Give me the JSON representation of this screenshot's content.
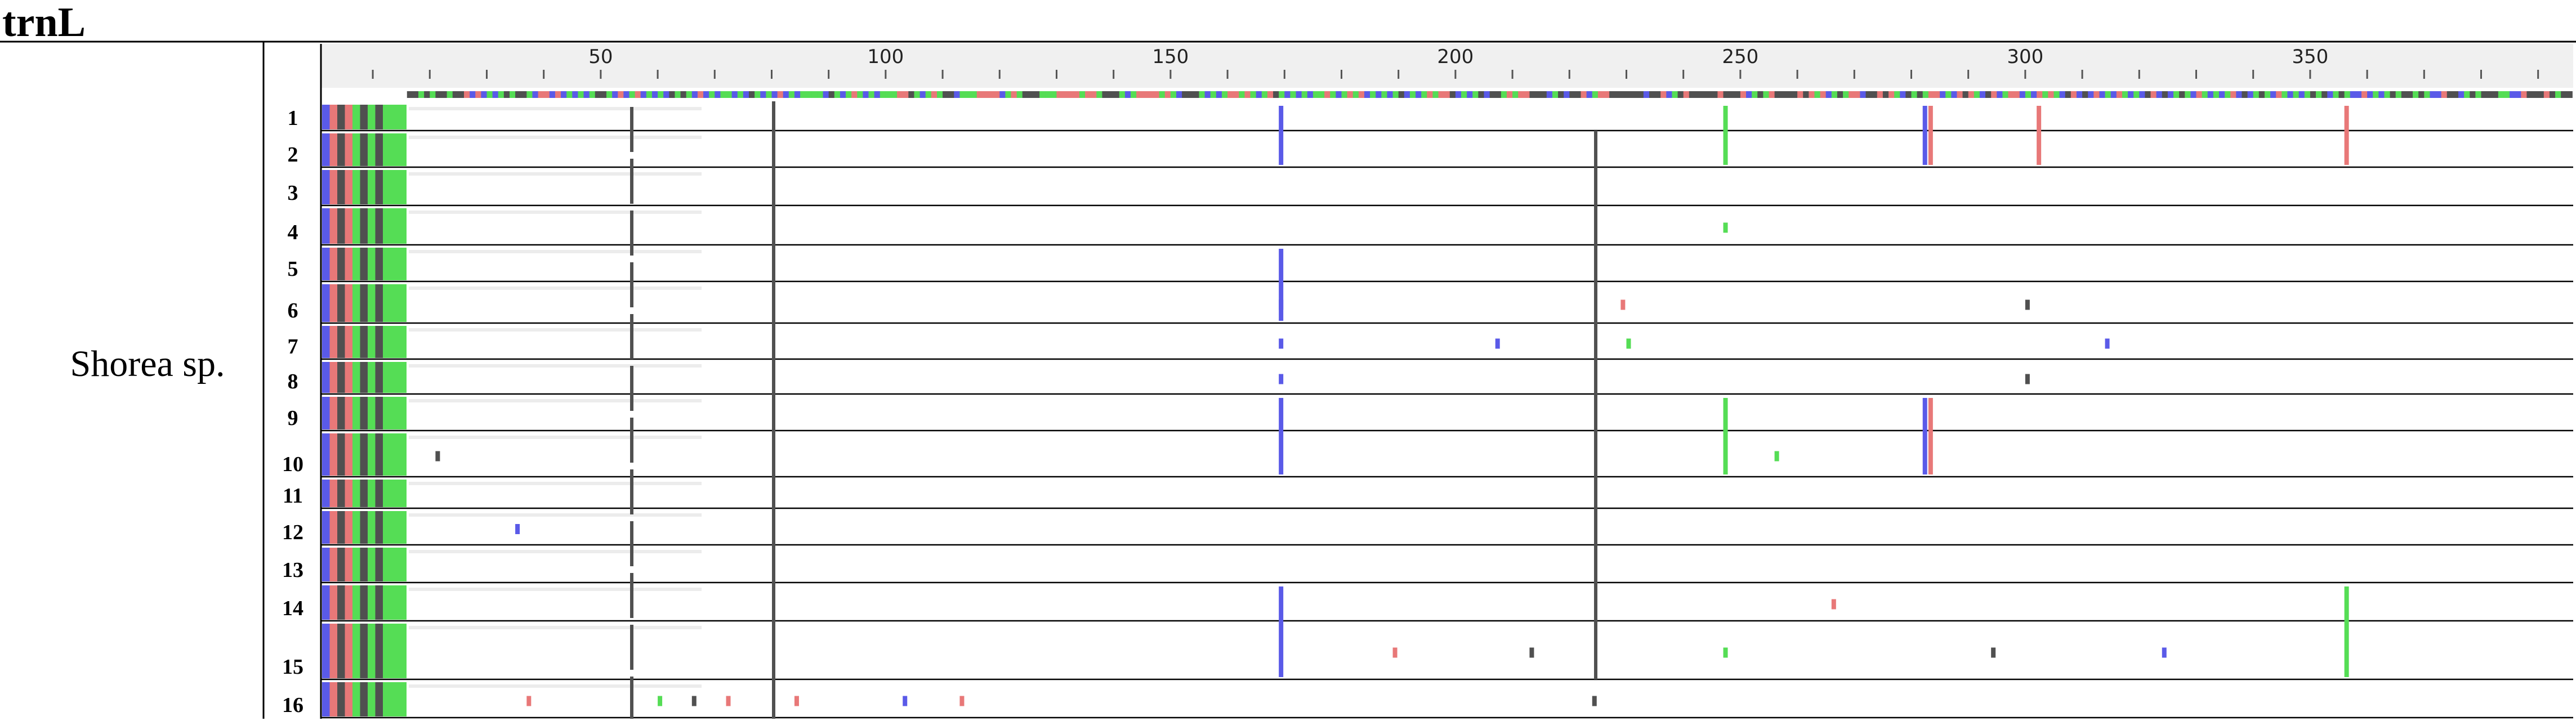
{
  "title": "trnL",
  "species_label": "Shorea sp.",
  "colors": {
    "A": "#e87878",
    "C": "#5a5ae8",
    "G": "#505050",
    "T": "#55dd55",
    "frame": "#000000",
    "ruler_bg": "#f0f0f0"
  },
  "ruler": {
    "min": 1,
    "max": 395,
    "tick_labels": [
      "50",
      "100",
      "150",
      "200",
      "250",
      "300",
      "350"
    ]
  },
  "rows": [
    {
      "label": "1"
    },
    {
      "label": "2"
    },
    {
      "label": "3"
    },
    {
      "label": "4"
    },
    {
      "label": "5"
    },
    {
      "label": "6"
    },
    {
      "label": "7"
    },
    {
      "label": "8"
    },
    {
      "label": "9"
    },
    {
      "label": "10"
    },
    {
      "label": "11"
    },
    {
      "label": "12"
    },
    {
      "label": "13"
    },
    {
      "label": "14"
    },
    {
      "label": "15"
    },
    {
      "label": "16"
    }
  ],
  "variants": [
    {
      "pos": 169,
      "base": "C",
      "rows": [
        1,
        2
      ]
    },
    {
      "pos": 247,
      "base": "T",
      "rows": [
        1,
        2
      ]
    },
    {
      "pos": 282,
      "base": "C",
      "rows": [
        1,
        2
      ]
    },
    {
      "pos": 283,
      "base": "A",
      "rows": [
        1,
        2
      ]
    },
    {
      "pos": 302,
      "base": "A",
      "rows": [
        1,
        2
      ]
    },
    {
      "pos": 356,
      "base": "A",
      "rows": [
        1,
        2
      ]
    },
    {
      "pos": 247,
      "base": "T",
      "rows": [
        4
      ]
    },
    {
      "pos": 169,
      "base": "C",
      "rows": [
        5,
        6
      ]
    },
    {
      "pos": 169,
      "base": "C",
      "rows": [
        6
      ]
    },
    {
      "pos": 169,
      "base": "C",
      "rows": [
        7
      ]
    },
    {
      "pos": 207,
      "base": "C",
      "rows": [
        7
      ]
    },
    {
      "pos": 229,
      "base": "A",
      "rows": [
        6
      ]
    },
    {
      "pos": 230,
      "base": "T",
      "rows": [
        7
      ]
    },
    {
      "pos": 300,
      "base": "G",
      "rows": [
        6
      ]
    },
    {
      "pos": 314,
      "base": "C",
      "rows": [
        7
      ]
    },
    {
      "pos": 169,
      "base": "C",
      "rows": [
        8
      ]
    },
    {
      "pos": 300,
      "base": "G",
      "rows": [
        8
      ]
    },
    {
      "pos": 169,
      "base": "C",
      "rows": [
        9,
        10
      ]
    },
    {
      "pos": 247,
      "base": "T",
      "rows": [
        9,
        10
      ]
    },
    {
      "pos": 256,
      "base": "T",
      "rows": [
        10
      ]
    },
    {
      "pos": 282,
      "base": "C",
      "rows": [
        9,
        10
      ]
    },
    {
      "pos": 283,
      "base": "A",
      "rows": [
        9,
        10
      ]
    },
    {
      "pos": 21,
      "base": "G",
      "rows": [
        10
      ]
    },
    {
      "pos": 35,
      "base": "C",
      "rows": [
        12
      ]
    },
    {
      "pos": 266,
      "base": "A",
      "rows": [
        14
      ]
    },
    {
      "pos": 169,
      "base": "C",
      "rows": [
        14,
        15
      ]
    },
    {
      "pos": 189,
      "base": "A",
      "rows": [
        15
      ]
    },
    {
      "pos": 213,
      "base": "G",
      "rows": [
        15
      ]
    },
    {
      "pos": 247,
      "base": "T",
      "rows": [
        15
      ]
    },
    {
      "pos": 294,
      "base": "G",
      "rows": [
        15
      ]
    },
    {
      "pos": 324,
      "base": "C",
      "rows": [
        15
      ]
    },
    {
      "pos": 356,
      "base": "T",
      "rows": [
        14,
        15
      ]
    },
    {
      "pos": 37,
      "base": "A",
      "rows": [
        16
      ]
    },
    {
      "pos": 66,
      "base": "G",
      "rows": [
        16
      ]
    },
    {
      "pos": 72,
      "base": "A",
      "rows": [
        16
      ]
    },
    {
      "pos": 84,
      "base": "A",
      "rows": [
        16
      ]
    },
    {
      "pos": 103,
      "base": "C",
      "rows": [
        16
      ]
    },
    {
      "pos": 113,
      "base": "A",
      "rows": [
        16
      ]
    },
    {
      "pos": 60,
      "base": "T",
      "rows": [
        16
      ]
    },
    {
      "pos": 224,
      "base": "G",
      "rows": [
        16
      ]
    }
  ]
}
